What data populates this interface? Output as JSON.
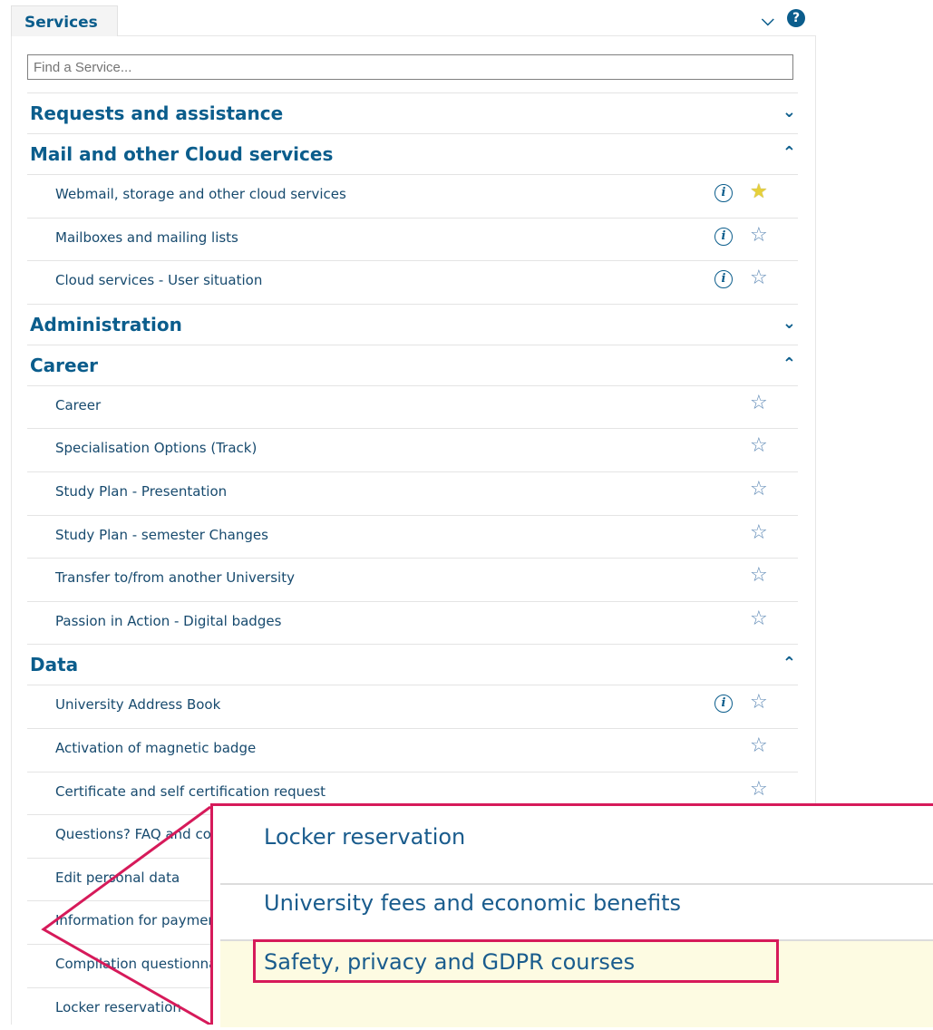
{
  "header": {
    "tab_label": "Services"
  },
  "search": {
    "placeholder": "Find a Service..."
  },
  "sections": [
    {
      "label": "Requests and assistance",
      "expanded": false,
      "items": []
    },
    {
      "label": "Mail and other Cloud services",
      "expanded": true,
      "items": [
        {
          "label": "Webmail, storage and other cloud services",
          "info": true,
          "favorite": true
        },
        {
          "label": "Mailboxes and mailing lists",
          "info": true,
          "favorite": false
        },
        {
          "label": "Cloud services - User situation",
          "info": true,
          "favorite": false
        }
      ]
    },
    {
      "label": "Administration",
      "expanded": false,
      "items": []
    },
    {
      "label": "Career",
      "expanded": true,
      "items": [
        {
          "label": "Career",
          "info": false,
          "favorite": false
        },
        {
          "label": "Specialisation Options (Track)",
          "info": false,
          "favorite": false
        },
        {
          "label": "Study Plan - Presentation",
          "info": false,
          "favorite": false
        },
        {
          "label": "Study Plan - semester Changes",
          "info": false,
          "favorite": false
        },
        {
          "label": "Transfer to/from another University",
          "info": false,
          "favorite": false
        },
        {
          "label": "Passion in Action - Digital badges",
          "info": false,
          "favorite": false
        }
      ]
    },
    {
      "label": "Data",
      "expanded": true,
      "items": [
        {
          "label": "University Address Book",
          "info": true,
          "favorite": false
        },
        {
          "label": "Activation of magnetic badge",
          "info": false,
          "favorite": false
        },
        {
          "label": "Certificate and self certification request",
          "info": false,
          "favorite": false
        },
        {
          "label": "Questions? FAQ and contacts",
          "info": false,
          "favorite": false
        },
        {
          "label": "Edit personal data",
          "info": false,
          "favorite": false
        },
        {
          "label": "Information for payment",
          "info": false,
          "favorite": false
        },
        {
          "label": "Compilation questionnaire",
          "info": false,
          "favorite": false
        },
        {
          "label": "Locker reservation",
          "info": false,
          "favorite": false
        }
      ]
    }
  ],
  "zoom": {
    "items": [
      "Locker reservation",
      "University fees and economic benefits",
      "Safety, privacy and GDPR courses"
    ],
    "highlighted_index": 2
  },
  "colors": {
    "accent": "#0b5d8c",
    "callout": "#d61a5a",
    "highlight_bg": "#fdfbe2",
    "favorite_star": "#e6d03a"
  },
  "icons": {
    "expand": "chevron-down-icon",
    "collapse": "chevron-up-icon",
    "help": "help-icon",
    "info": "info-icon",
    "favorite": "star-icon"
  }
}
